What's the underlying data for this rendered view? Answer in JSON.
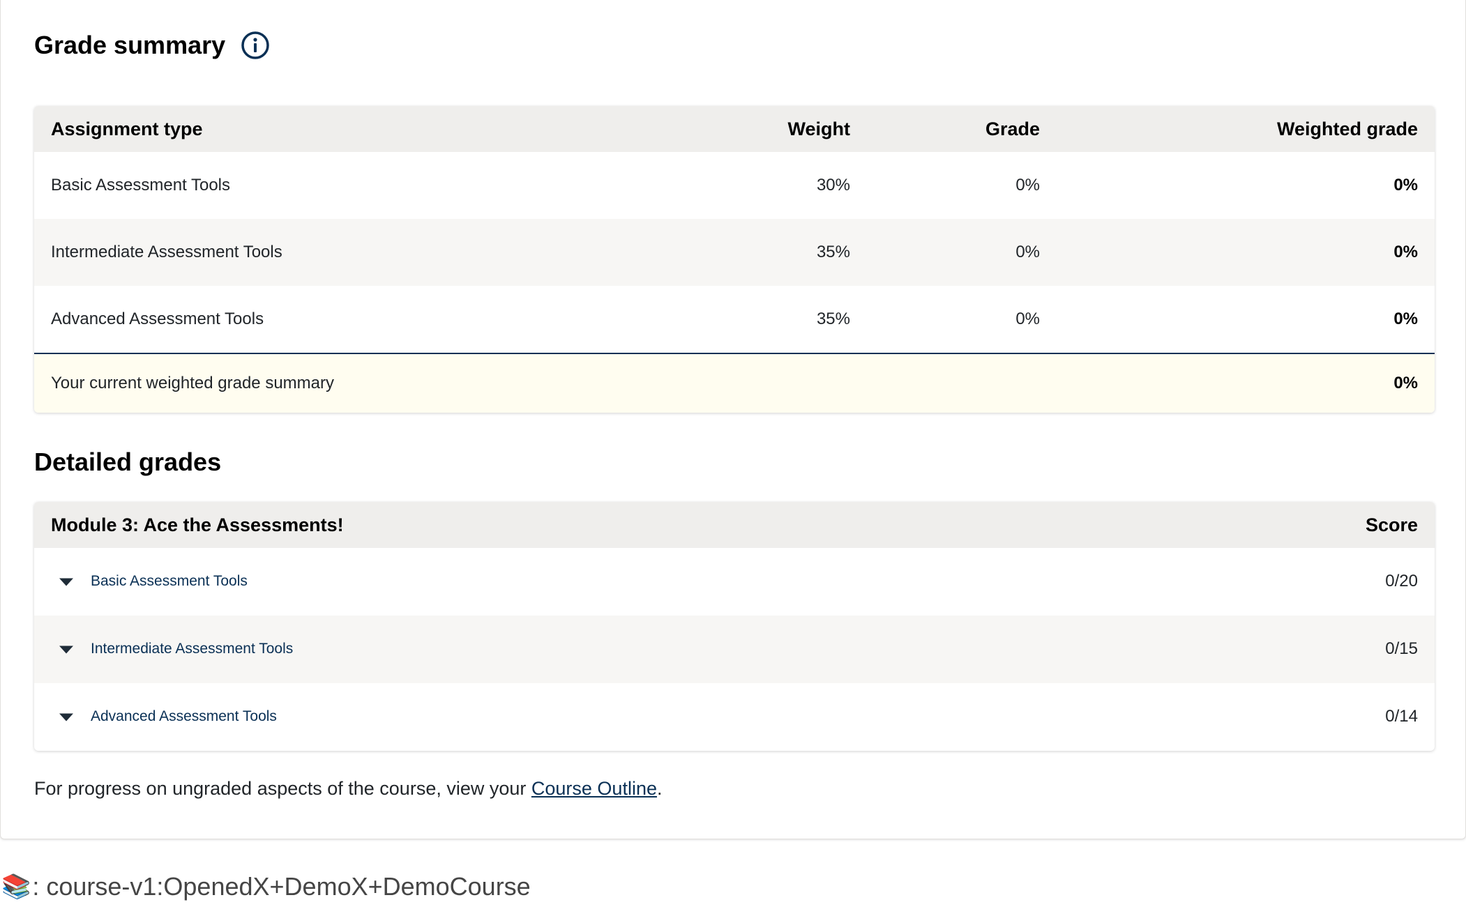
{
  "grade_summary": {
    "title": "Grade summary",
    "info_icon": "info-circle-icon",
    "headers": {
      "assignment_type": "Assignment type",
      "weight": "Weight",
      "grade": "Grade",
      "weighted_grade": "Weighted grade"
    },
    "rows": [
      {
        "type": "Basic Assessment Tools",
        "weight": "30%",
        "grade": "0%",
        "weighted_grade": "0%"
      },
      {
        "type": "Intermediate Assessment Tools",
        "weight": "35%",
        "grade": "0%",
        "weighted_grade": "0%"
      },
      {
        "type": "Advanced Assessment Tools",
        "weight": "35%",
        "grade": "0%",
        "weighted_grade": "0%"
      }
    ],
    "summary": {
      "label": "Your current weighted grade summary",
      "value": "0%"
    }
  },
  "detailed_grades": {
    "title": "Detailed grades",
    "module_title": "Module 3: Ace the Assessments!",
    "score_header": "Score",
    "rows": [
      {
        "label": "Basic Assessment Tools",
        "score": "0/20"
      },
      {
        "label": "Intermediate Assessment Tools",
        "score": "0/15"
      },
      {
        "label": "Advanced Assessment Tools",
        "score": "0/14"
      }
    ]
  },
  "footer": {
    "text_before": "For progress on ungraded aspects of the course, view your ",
    "link": "Course Outline",
    "text_after": "."
  },
  "course_id": {
    "icon": "books-icon",
    "icon_glyph": "📚",
    "text": ": course-v1:OpenedX+DemoX+DemoCourse"
  },
  "colors": {
    "header_bg": "#efeeec",
    "alt_row_bg": "#f7f6f4",
    "summary_bg": "#fffdf0",
    "link": "#0a3055",
    "divider": "#0a3055"
  }
}
